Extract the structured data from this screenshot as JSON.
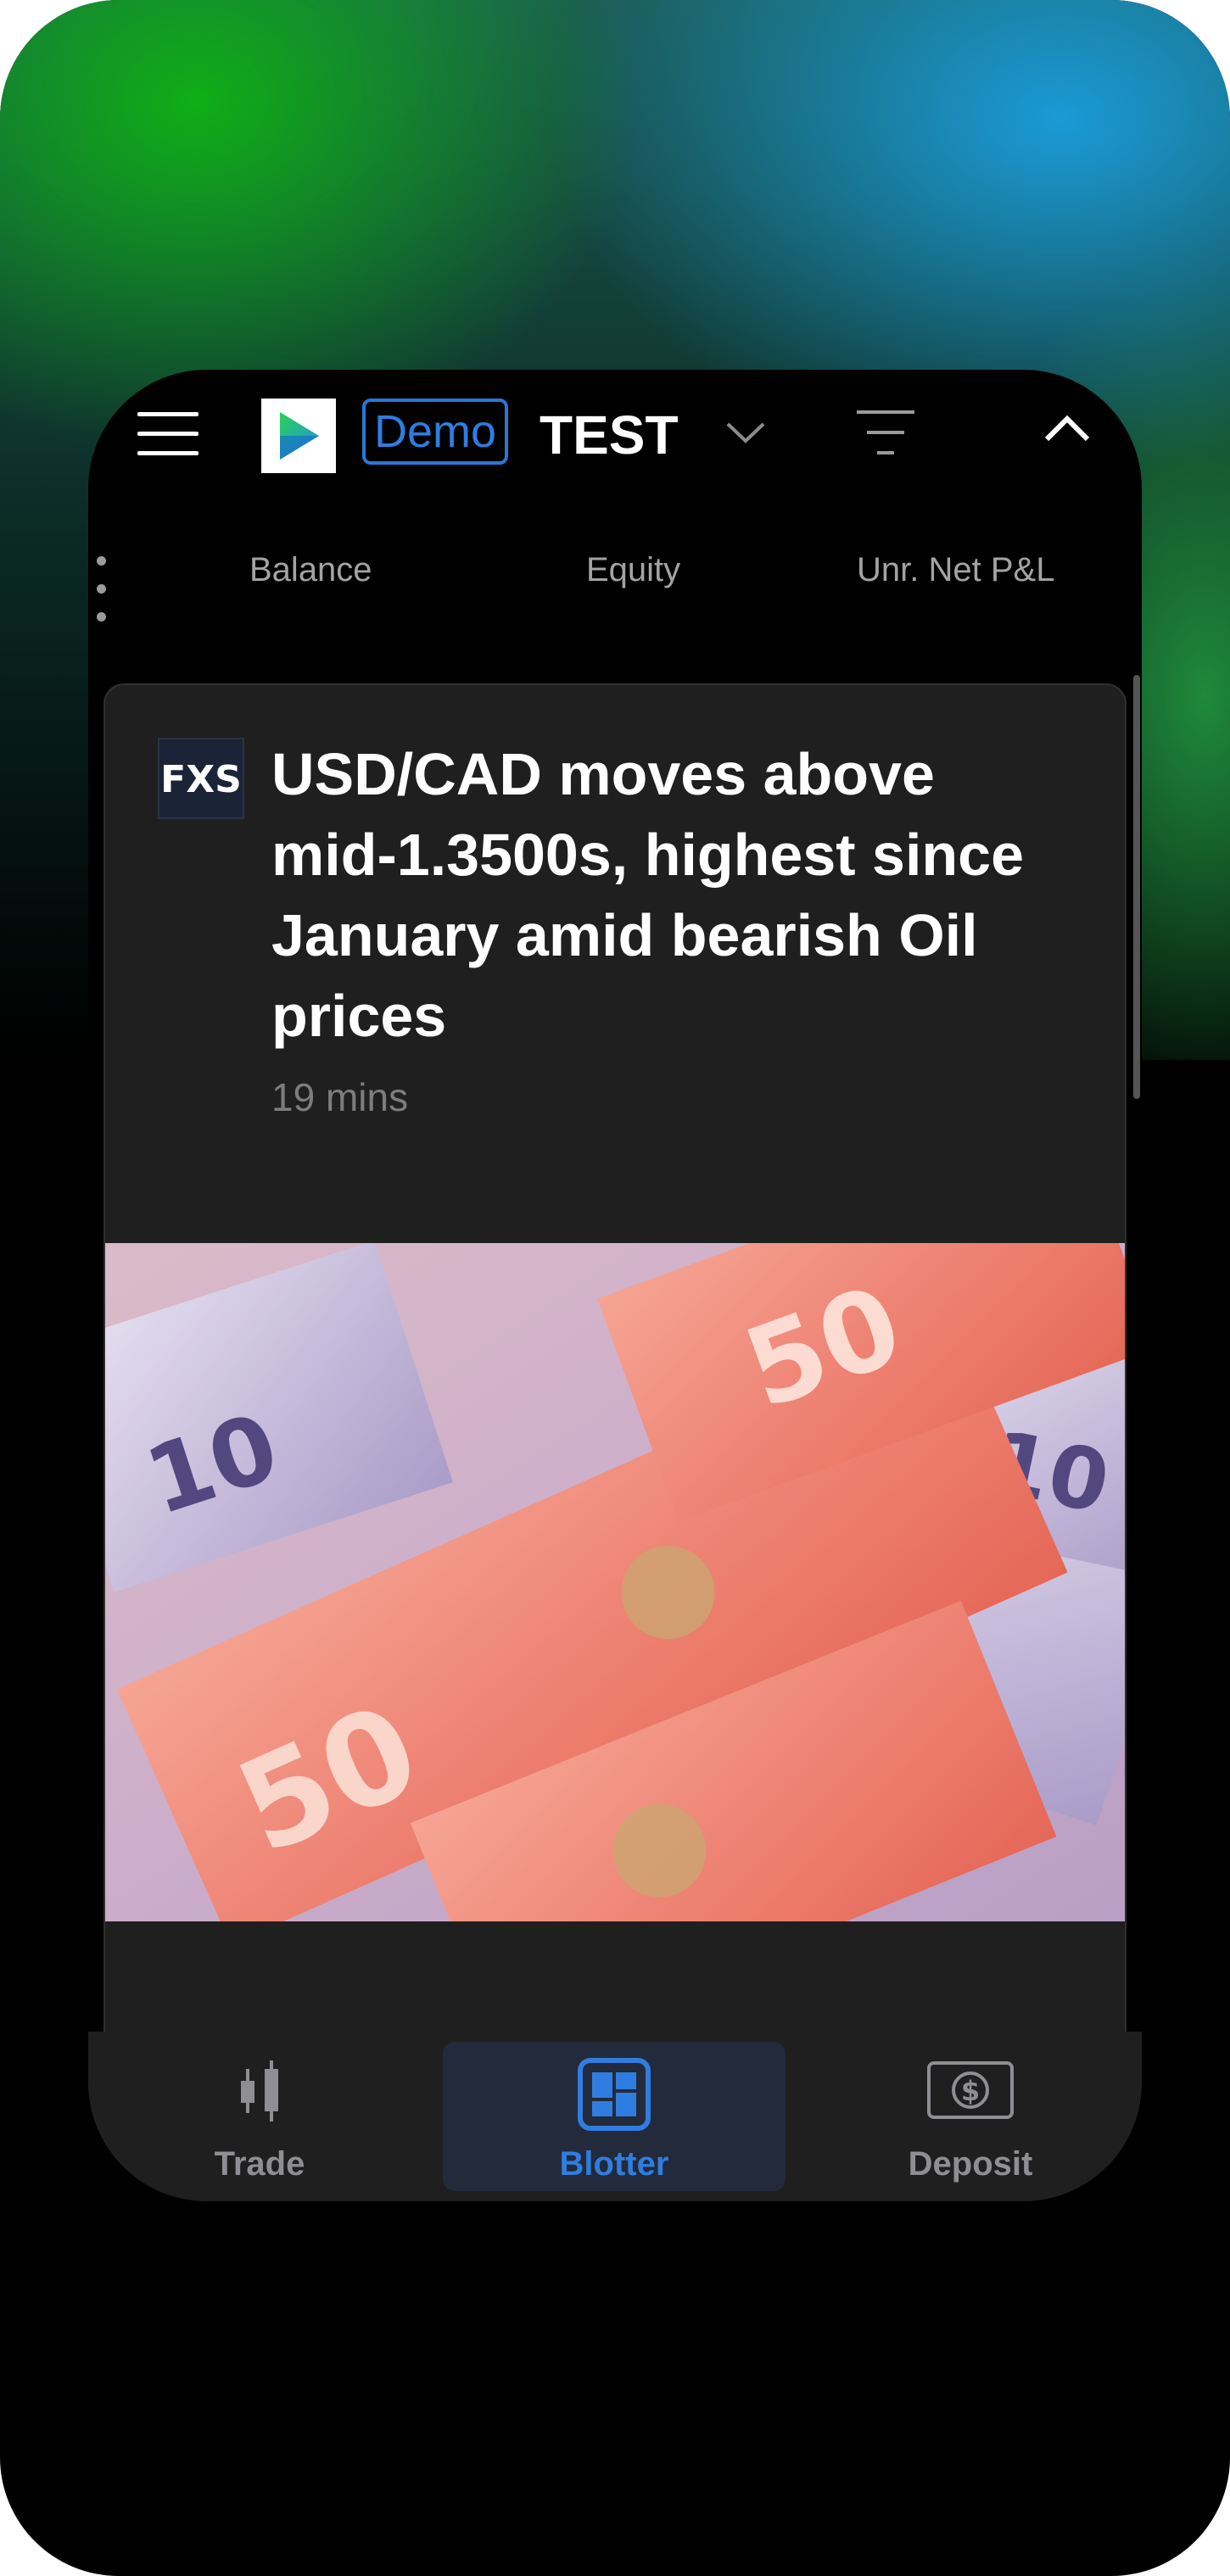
{
  "header": {
    "account_mode": "Demo",
    "account_name": "TEST"
  },
  "metrics": [
    {
      "label": "Balance"
    },
    {
      "label": "Equity"
    },
    {
      "label": "Unr. Net P&L"
    }
  ],
  "news": {
    "source_logo_text": "FXS",
    "headline": "USD/CAD moves above mid-1.3500s, highest since January amid bearish Oil prices",
    "time_ago": "19 mins"
  },
  "bottom_nav": {
    "items": [
      {
        "label": "Trade"
      },
      {
        "label": "Blotter"
      },
      {
        "label": "Deposit"
      }
    ],
    "active": "Blotter"
  },
  "colors": {
    "accent": "#2f7de0",
    "nav_inactive": "#8e8e93",
    "card_bg": "#1f1f1f"
  }
}
